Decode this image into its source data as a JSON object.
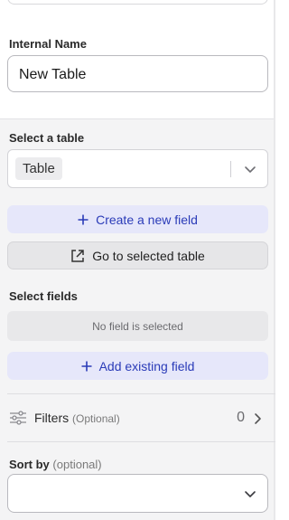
{
  "internal_name": {
    "label": "Internal Name",
    "value": "New Table"
  },
  "table_section": {
    "label": "Select a table",
    "selected_chip": "Table",
    "create_field_label": "Create a new field",
    "go_to_table_label": "Go to selected table"
  },
  "fields_section": {
    "label": "Select fields",
    "empty_text": "No field is selected",
    "add_existing_label": "Add existing field"
  },
  "filters": {
    "label": "Filters",
    "optional_text": "(Optional)",
    "count": "0"
  },
  "sort": {
    "label": "Sort by",
    "optional_text": "(optional)",
    "value": ""
  },
  "icons": {
    "plus": "plus-icon",
    "external": "external-link-icon",
    "chevron": "chevron-down-icon",
    "filters": "sliders-icon",
    "arrow": "chevron-right-icon"
  },
  "colors": {
    "accent": "#2a3bb8",
    "accent_bg": "#e6e7fa",
    "panel_gray": "#f4f4f5"
  }
}
